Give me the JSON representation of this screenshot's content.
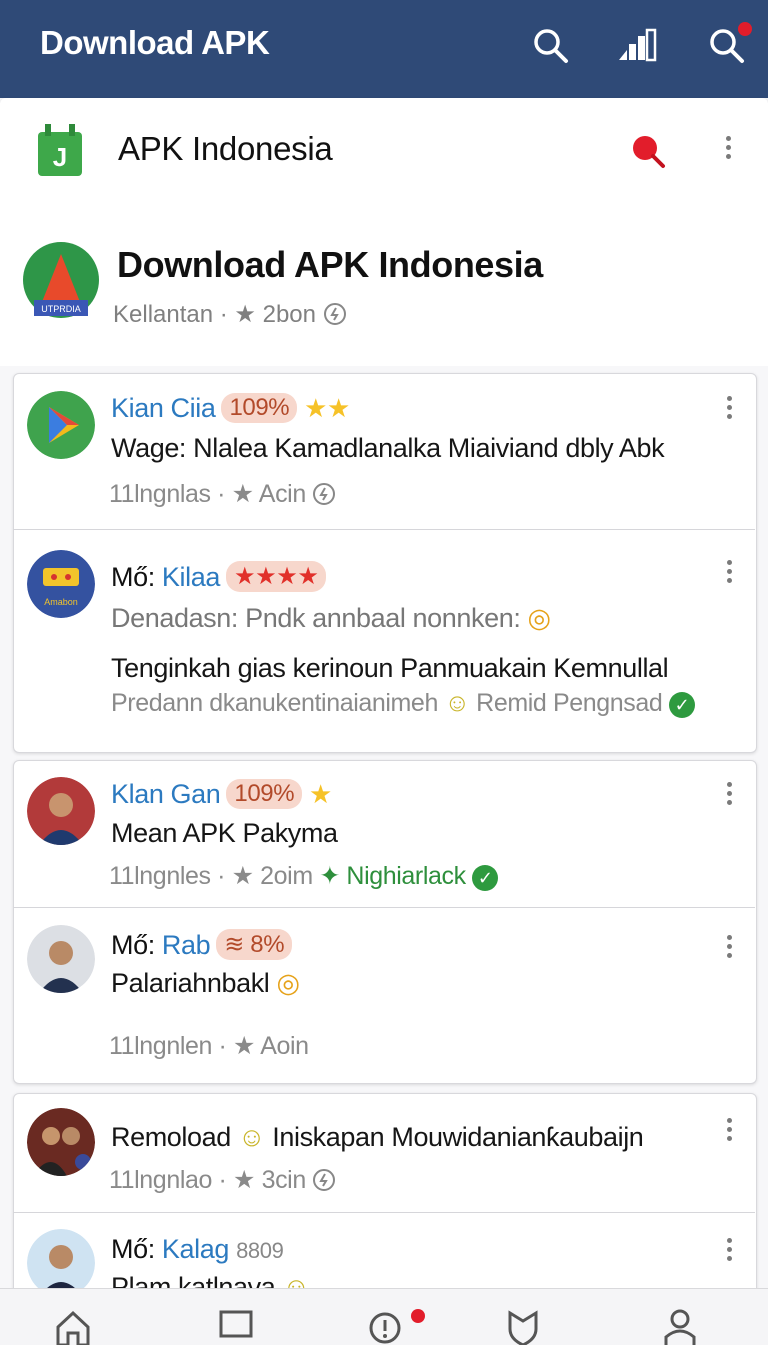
{
  "topbar": {
    "title": "Download APK"
  },
  "appbar": {
    "logo_letter": "J",
    "name": "APK Indonesia"
  },
  "header": {
    "avatar_caption": "UTPRDIA",
    "title": "Download APK Indonesia",
    "meta_location": "Kellantan",
    "meta_count": "2bon"
  },
  "posts": [
    {
      "prefix": "",
      "username": "Kian Ciia",
      "badge": "109%",
      "line1": "Wage: Nlalea Kamadlanalka Miaiviand dbly Abk",
      "line2": "",
      "line3": "",
      "meta_time": "11lngnlas",
      "meta_count": "Acin",
      "meta_extra": ""
    },
    {
      "prefix": "Mő:",
      "username": "Kilaa",
      "badge": "",
      "line1": "Denadasn: Pndk annbaal nonnken:",
      "line2": "Tenginkah gias kerinoun Panmuakain Kemnullal",
      "line3": "Predann dkanukentinaianimeh",
      "line3_extra": "Remid Pengnsad",
      "avatar_caption": "Amabon",
      "meta_time": "",
      "meta_count": "",
      "meta_extra": ""
    },
    {
      "prefix": "",
      "username": "Klan Gan",
      "badge": "109%",
      "line1": "Mean APK Pakyma",
      "meta_time": "11lngnles",
      "meta_count": "2oim",
      "meta_extra": "Nighiarlack"
    },
    {
      "prefix": "Mő:",
      "username": "Rab",
      "badge": "8%",
      "line1": "Palariahnbakl",
      "meta_time": "11lngnlen",
      "meta_count": "Aoin",
      "meta_extra": ""
    },
    {
      "prefix": "",
      "username": "",
      "badge": "",
      "line1_a": "Remoload",
      "line1_b": "Iniskapan Mouwidanianƙaubaijn",
      "meta_time": "11lngnlao",
      "meta_count": "3cin",
      "meta_extra": ""
    },
    {
      "prefix": "Mő:",
      "username": "Kalag",
      "badge": "8809",
      "line1": "Plam katlnava",
      "meta_time": "",
      "meta_count": "",
      "meta_extra": ""
    }
  ],
  "colors": {
    "topbar": "#2f4a77",
    "link": "#2c7ac0",
    "accent_red": "#e21d2b",
    "green": "#2e8f3c"
  },
  "icons": [
    "search-icon",
    "signal-icon",
    "search-notification-icon",
    "app-logo-icon",
    "pin-icon",
    "more-vert-icon",
    "home-icon",
    "square-icon",
    "alert-icon",
    "shield-icon",
    "profile-icon"
  ]
}
